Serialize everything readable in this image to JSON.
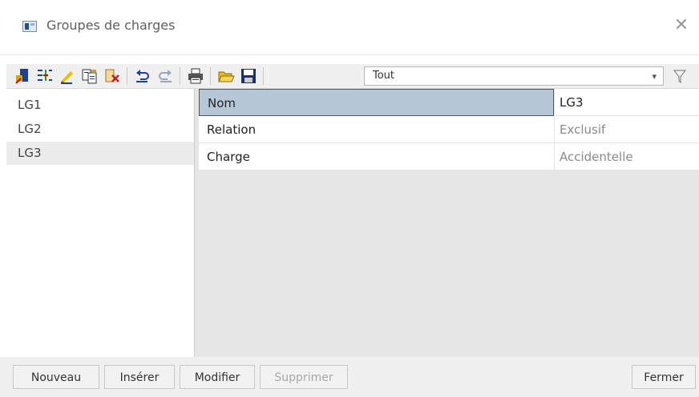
{
  "window": {
    "title": "Groupes de charges",
    "close_icon": "close-icon"
  },
  "toolbar": {
    "icons": [
      "new-group-icon",
      "insert-rows-icon",
      "edit-pencil-icon",
      "copy-icon",
      "delete-icon",
      "undo-icon",
      "redo-icon",
      "print-icon",
      "open-folder-icon",
      "save-icon"
    ],
    "filter": {
      "selected": "Tout",
      "icon": "chevron-down-icon"
    },
    "filter_button_icon": "filter-funnel-icon"
  },
  "list": {
    "items": [
      {
        "label": "LG1"
      },
      {
        "label": "LG2"
      },
      {
        "label": "LG3",
        "selected": true
      }
    ]
  },
  "properties": {
    "rows": [
      {
        "name": "Nom",
        "value": "LG3"
      },
      {
        "name": "Relation",
        "value": "Exclusif"
      },
      {
        "name": "Charge",
        "value": "Accidentelle"
      }
    ]
  },
  "buttons": {
    "new": "Nouveau",
    "insert": "Insérer",
    "modify": "Modifier",
    "delete": "Supprimer",
    "close": "Fermer"
  },
  "colors": {
    "accent_selected_cell": "#b8c7d8",
    "toolbar_bg": "#f0f0f0",
    "panel_bg": "#e6e6e6"
  }
}
